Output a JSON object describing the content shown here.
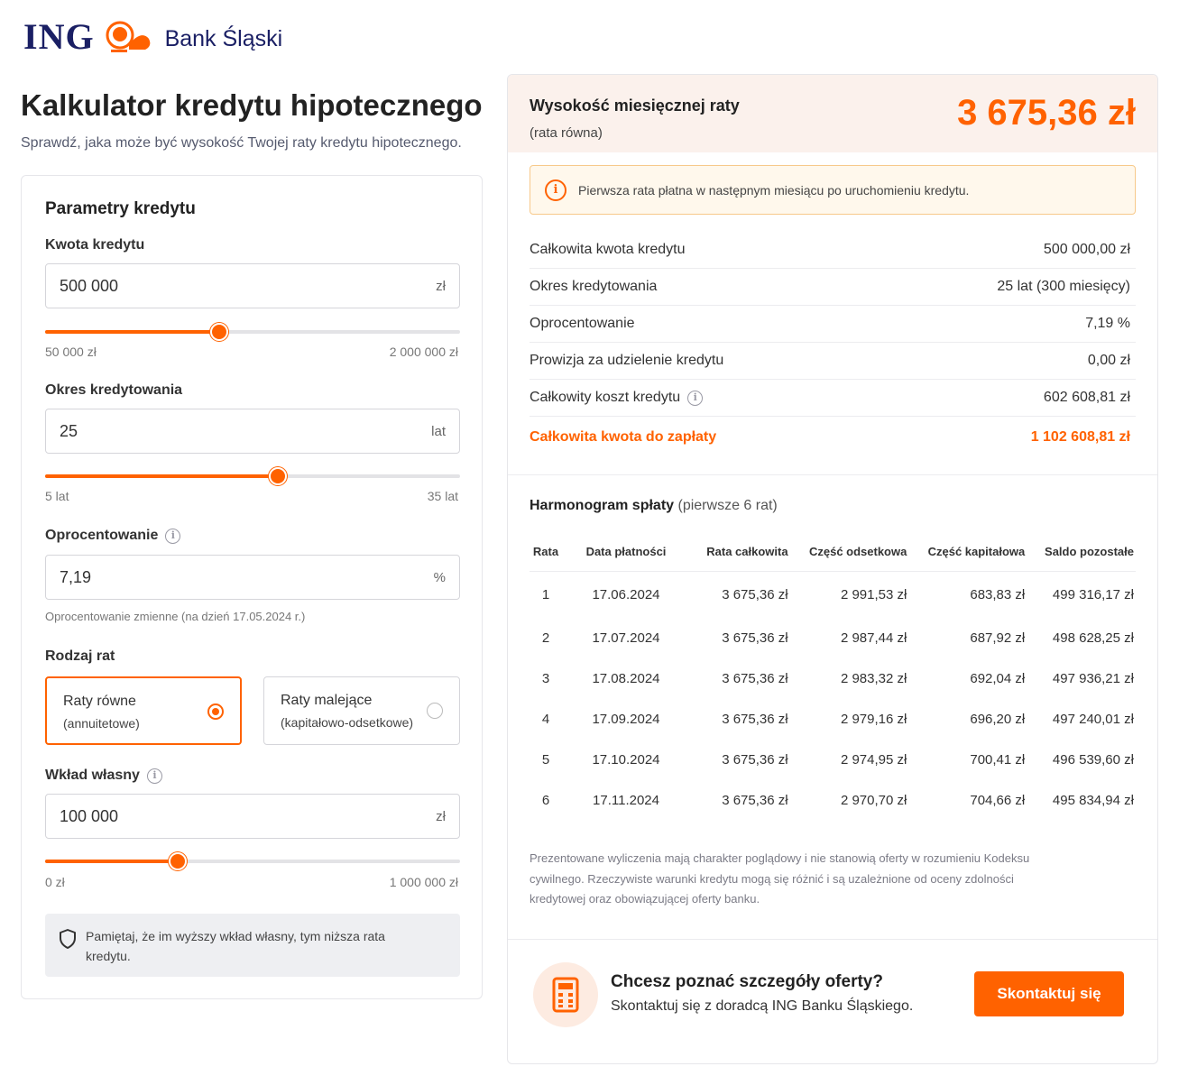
{
  "brand": {
    "ing": "ING",
    "bank": "Bank Śląski",
    "accent": "#ff6200",
    "navy": "#1a1f64"
  },
  "page": {
    "title": "Kalkulator kredytu hipotecznego",
    "subtitle": "Sprawdź, jaka może być wysokość Twojej raty kredytu hipotecznego."
  },
  "params": {
    "title": "Parametry kredytu",
    "amount": {
      "label": "Kwota kredytu",
      "value": "500 000",
      "unit": "zł",
      "min": "50 000 zł",
      "max": "2 000 000 zł",
      "slider_fraction": 0.42
    },
    "period": {
      "label": "Okres kredytowania",
      "value": "25",
      "unit": "lat",
      "min": "5 lat",
      "max": "35 lat",
      "slider_fraction": 0.56
    },
    "rate": {
      "label": "Oprocentowanie",
      "value": "7,19",
      "unit": "%",
      "note": "Oprocentowanie zmienne (na dzień 17.05.2024 r.)"
    },
    "installment_type": {
      "label": "Rodzaj rat",
      "options": [
        {
          "title": "Raty równe",
          "sub": "(annuitetowe)",
          "selected": true
        },
        {
          "title": "Raty malejące",
          "sub": "(kapitałowo-odsetkowe)",
          "selected": false
        }
      ]
    },
    "own_contribution": {
      "label": "Wkład własny",
      "value": "100 000",
      "unit": "zł",
      "min": "0 zł",
      "max": "1 000 000 zł",
      "slider_fraction": 0.32
    },
    "tip": "Pamiętaj, że im wyższy wkład własny, tym niższa rata kredytu."
  },
  "result": {
    "label": "Wysokość miesięcznej raty",
    "sublabel": "(rata równa)",
    "amount": "3 675,36 zł",
    "alert": "Pierwsza rata płatna w następnym miesiącu po uruchomieniu kredytu.",
    "summary": [
      {
        "label": "Całkowita kwota kredytu",
        "value": "500 000,00 zł"
      },
      {
        "label": "Okres kredytowania",
        "value": "25 lat (300 miesięcy)"
      },
      {
        "label": "Oprocentowanie",
        "value": "7,19 %"
      },
      {
        "label": "Prowizja za udzielenie kredytu",
        "value": "0,00 zł"
      },
      {
        "label": "Całkowity koszt kredytu",
        "value": "602 608,81 zł"
      }
    ],
    "total": {
      "label": "Całkowita kwota do zapłaty",
      "value": "1 102 608,81 zł"
    },
    "schedule": {
      "title": "Harmonogram spłaty",
      "subtitle": "(pierwsze 6 rat)",
      "headers": [
        "Rata",
        "Data płatności",
        "Rata całkowita",
        "Część odsetkowa",
        "Część kapitałowa",
        "Saldo pozostałe"
      ],
      "rows": [
        [
          "1",
          "17.06.2024",
          "3 675,36 zł",
          "2 991,53 zł",
          "683,83 zł",
          "499 316,17 zł"
        ],
        [
          "2",
          "17.07.2024",
          "3 675,36 zł",
          "2 987,44 zł",
          "687,92 zł",
          "498 628,25 zł"
        ],
        [
          "3",
          "17.08.2024",
          "3 675,36 zł",
          "2 983,32 zł",
          "692,04 zł",
          "497 936,21 zł"
        ],
        [
          "4",
          "17.09.2024",
          "3 675,36 zł",
          "2 979,16 zł",
          "696,20 zł",
          "497 240,01 zł"
        ],
        [
          "5",
          "17.10.2024",
          "3 675,36 zł",
          "2 974,95 zł",
          "700,41 zł",
          "496 539,60 zł"
        ],
        [
          "6",
          "17.11.2024",
          "3 675,36 zł",
          "2 970,70 zł",
          "704,66 zł",
          "495 834,94 zł"
        ]
      ]
    },
    "disclaimer": "Prezentowane wyliczenia mają charakter poglądowy i nie stanowią oferty w rozumieniu Kodeksu cywilnego. Rzeczywiste warunki kredytu mogą się różnić i są uzależnione od oceny zdolności kredytowej oraz obowiązującej oferty banku.",
    "cta": {
      "title": "Chcesz poznać szczegóły oferty?",
      "sub": "Skontaktuj się z doradcą ING Banku Śląskiego.",
      "button": "Skontaktuj się"
    }
  }
}
